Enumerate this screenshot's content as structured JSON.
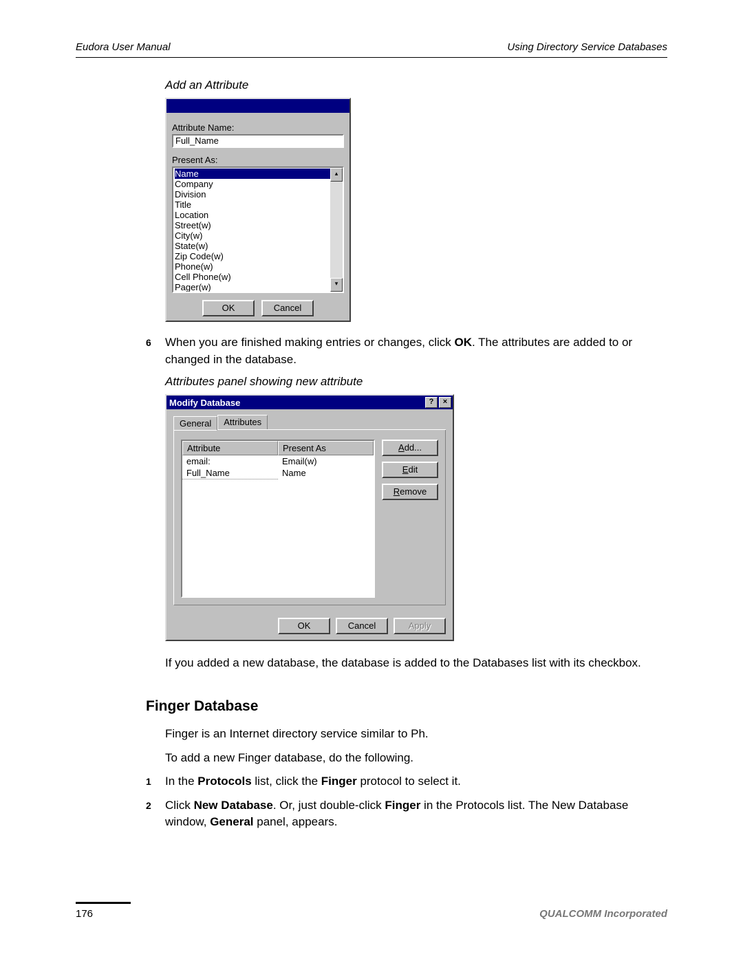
{
  "header": {
    "left": "Eudora User Manual",
    "right": "Using Directory Service Databases"
  },
  "caption1": "Add an Attribute",
  "dlg1": {
    "attr_label": "Attribute Name:",
    "attr_value": "Full_Name",
    "present_label": "Present As:",
    "list": [
      "Name",
      "Company",
      "Division",
      "Title",
      "Location",
      "Street(w)",
      "City(w)",
      "State(w)",
      "Zip Code(w)",
      "Phone(w)",
      "Cell Phone(w)",
      "Pager(w)"
    ],
    "ok": "OK",
    "cancel": "Cancel"
  },
  "step6_num": "6",
  "step6_a": "When you are finished making entries or changes, click ",
  "step6_b": "OK",
  "step6_c": ". The attributes are added to or changed in the database.",
  "caption2": "Attributes panel showing new attribute",
  "dlg2": {
    "title": "Modify Database",
    "tab_general": "General",
    "tab_attributes": "Attributes",
    "col_attr": "Attribute",
    "col_present": "Present As",
    "rows": [
      {
        "attr": "email:",
        "present": "Email(w)"
      },
      {
        "attr": "Full_Name",
        "present": "Name"
      }
    ],
    "add": "Add...",
    "edit": "Edit",
    "remove": "Remove",
    "ok": "OK",
    "cancel": "Cancel",
    "apply": "Apply"
  },
  "para_after": "If you added a new database, the database is added to the Databases list with its checkbox.",
  "section_title": "Finger Database",
  "para_f1": "Finger is an Internet directory service similar to Ph.",
  "para_f2": "To add a new Finger database, do the following.",
  "step1_num": "1",
  "step1_a": "In the ",
  "step1_b": "Protocols",
  "step1_c": " list, click the ",
  "step1_d": "Finger",
  "step1_e": " protocol to select it.",
  "step2_num": "2",
  "step2_a": "Click ",
  "step2_b": "New Database",
  "step2_c": ". Or, just double-click ",
  "step2_d": "Finger",
  "step2_e": " in the Protocols list. The New Database window, ",
  "step2_f": "General",
  "step2_g": " panel, appears.",
  "footer": {
    "page": "176",
    "corp": "QUALCOMM Incorporated"
  }
}
